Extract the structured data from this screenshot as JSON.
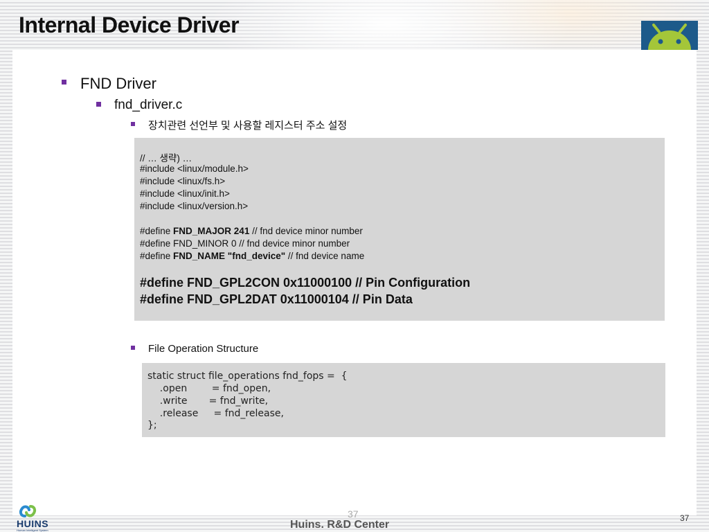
{
  "slide": {
    "title": "Internal Device Driver",
    "level1": "FND Driver",
    "level2": "fnd_driver.c",
    "section1": "장치관련 선언부 및 사용할 레지스터 주소 설정",
    "section2": "File Operation Structure"
  },
  "code1": {
    "comment": "// … 생략) …",
    "includes": [
      "#include <linux/module.h>",
      "#include <linux/fs.h>",
      "#include <linux/init.h>",
      "#include <linux/version.h>"
    ],
    "define_prefix": "#define ",
    "major_bold": "FND_MAJOR 241",
    "major_tail": " // fnd device minor number",
    "minor_line": "#define FND_MINOR 0 // fnd device minor number",
    "name_bold": "FND_NAME \"fnd_device\"",
    "name_tail": " // fnd device name",
    "gpl2con": "#define FND_GPL2CON 0x11000100 // Pin Configuration",
    "gpl2dat": "#define FND_GPL2DAT 0x11000104 // Pin Data"
  },
  "code2": {
    "lines": [
      "static struct file_operations fnd_fops =  {",
      "    .open        = fnd_open,",
      "    .write       = fnd_write,",
      "    .release     = fnd_release,",
      "};"
    ]
  },
  "footer": {
    "company_logo": "HUINS",
    "logo_tagline": "Human Intelligent System",
    "center": "Huins. R&D Center",
    "ghost_number": "37",
    "page_number": "37"
  },
  "colors": {
    "bullet": "#7030a0",
    "android_green": "#a4c639",
    "android_bg": "#1d5a8a"
  },
  "icons": {
    "brand": "android-icon",
    "company": "huins-logo-icon"
  }
}
